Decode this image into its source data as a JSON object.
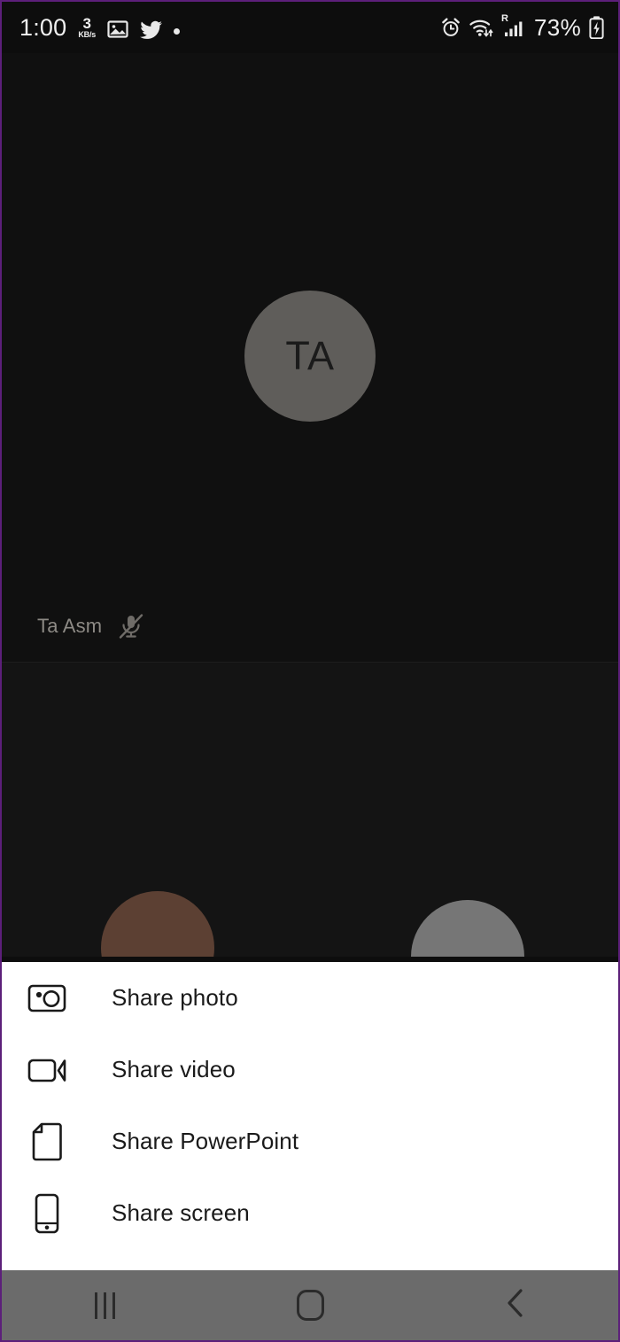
{
  "status_bar": {
    "time": "1:00",
    "data_rate_value": "3",
    "data_rate_unit": "KB/s",
    "icons_left": [
      "image-icon",
      "twitter-icon",
      "dot-indicator"
    ],
    "icons_right": [
      "alarm-icon",
      "wifi-icon",
      "roaming-signal-icon",
      "battery-charging-icon"
    ],
    "roaming_label": "R",
    "battery_percent": "73%"
  },
  "call": {
    "main_participant": {
      "initials": "TA",
      "name": "Ta Asm",
      "mic_state": "muted",
      "mic_icon": "microphone-muted-icon",
      "avatar_color": "#5f5d5a"
    },
    "secondary_participants": [
      {
        "avatar_color": "#5c4033"
      },
      {
        "avatar_color": "#767676"
      }
    ]
  },
  "share_sheet": {
    "items": [
      {
        "label": "Share photo",
        "icon": "camera-icon"
      },
      {
        "label": "Share video",
        "icon": "video-camera-icon"
      },
      {
        "label": "Share PowerPoint",
        "icon": "document-page-icon"
      },
      {
        "label": "Share screen",
        "icon": "mobile-phone-icon"
      }
    ]
  },
  "nav_bar": {
    "buttons": [
      {
        "name": "recent-apps",
        "icon": "recent-apps-icon"
      },
      {
        "name": "home",
        "icon": "home-icon"
      },
      {
        "name": "back",
        "icon": "back-chevron-icon"
      }
    ]
  },
  "colors": {
    "frame_border": "#5c1f7a",
    "stage_background": "#101010",
    "sheet_background": "#ffffff",
    "nav_background": "#6b6b6b",
    "text_primary": "#1a1a1a",
    "name_text": "#8d8a85"
  }
}
